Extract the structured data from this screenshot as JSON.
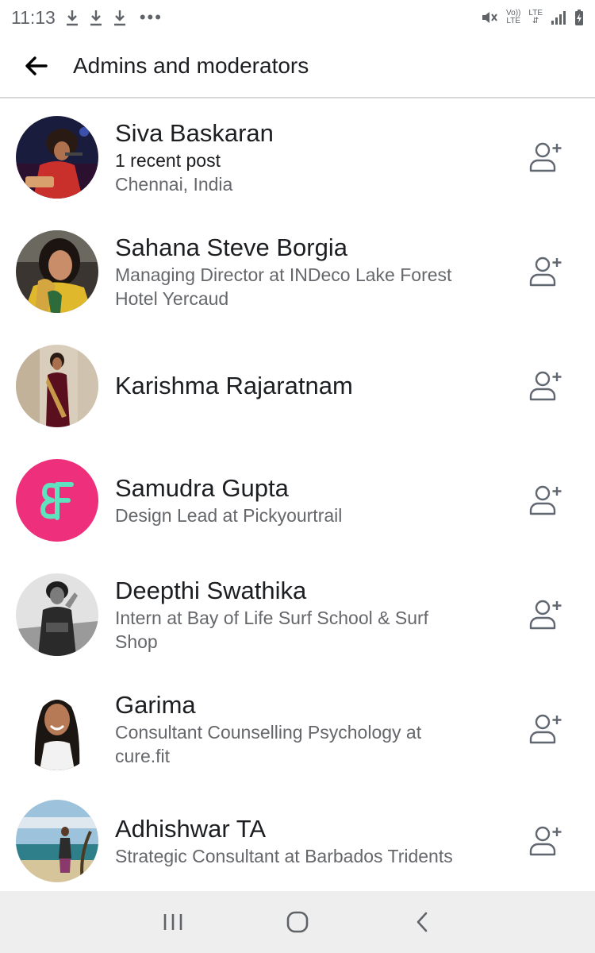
{
  "status_bar": {
    "time": "11:13",
    "more": "•••",
    "volte": "Vo))",
    "lte_small": "LTE",
    "lte": "LTE",
    "icons": [
      "download-icon",
      "download-icon",
      "download-icon",
      "mute-icon",
      "signal-icon",
      "battery-charging-icon"
    ]
  },
  "header": {
    "title": "Admins and moderators",
    "back_icon": "arrow-left-icon"
  },
  "members": [
    {
      "name": "Siva Baskaran",
      "line1": "1 recent post",
      "line2": "Chennai, India"
    },
    {
      "name": "Sahana Steve Borgia",
      "line1": "Managing Director at INDeco Lake Forest",
      "line2": "Hotel Yercaud"
    },
    {
      "name": "Karishma Rajaratnam",
      "line1": "",
      "line2": ""
    },
    {
      "name": "Samudra Gupta",
      "line1": "Design Lead at Pickyourtrail",
      "line2": ""
    },
    {
      "name": "Deepthi Swathika",
      "line1": "Intern at Bay of Life  Surf School & Surf",
      "line2": "Shop"
    },
    {
      "name": "Garima",
      "line1": "Consultant Counselling Psychology at",
      "line2": "cure.fit"
    },
    {
      "name": "Adhishwar TA",
      "line1": "Strategic Consultant at Barbados Tridents",
      "line2": ""
    }
  ],
  "colors": {
    "accent_pink": "#ee2f7b",
    "logo_mint": "#5fe3bf",
    "secondary_text": "#65676b",
    "nav_bg": "#eeeeee"
  },
  "nav_bar": {
    "icons": [
      "recents-icon",
      "home-icon",
      "back-icon"
    ]
  }
}
